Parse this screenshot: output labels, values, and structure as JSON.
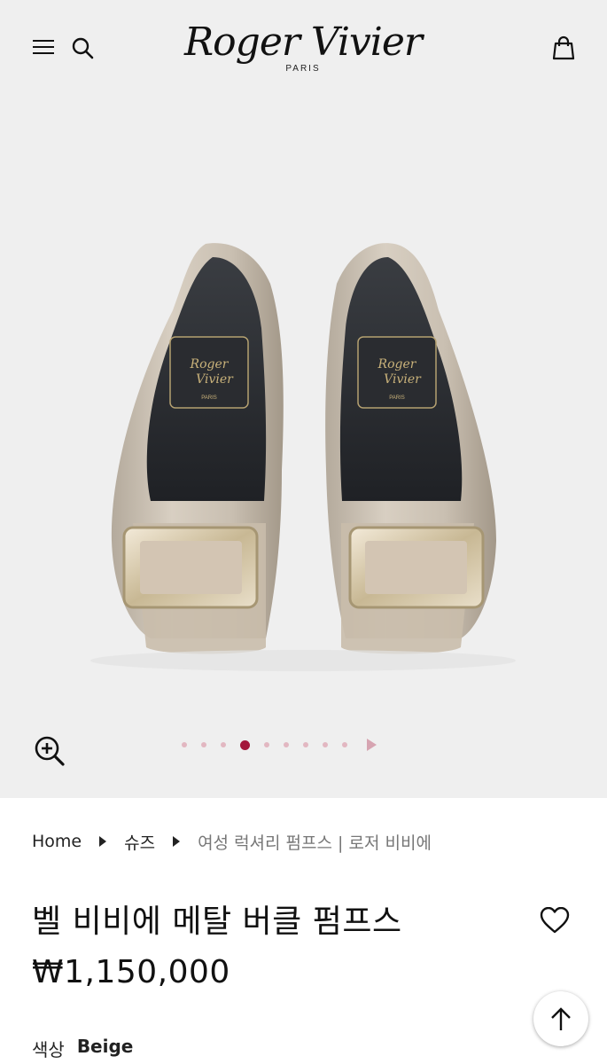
{
  "header": {
    "logo_text": "Roger Vivier",
    "logo_sub": "PARIS",
    "menu_icon": "hamburger-menu-icon",
    "search_icon": "search-icon",
    "cart_icon": "shopping-bag-icon"
  },
  "gallery": {
    "image_alt": "Beige patent pumps with metal buckle",
    "zoom_icon": "zoom-in-icon",
    "dot_count": 9,
    "active_dot": 4,
    "next_icon": "triangle-right-icon",
    "colors": {
      "active_dot": "#a3173a",
      "dot": "#e2b7c1"
    }
  },
  "breadcrumb": {
    "items": [
      "Home",
      "슈즈",
      "여성 럭셔리 펌프스 | 로저 비비에"
    ]
  },
  "product": {
    "title": "벨 비비에 메탈 버클 펌프스",
    "price": "₩1,150,000",
    "color_label": "색상",
    "color_value": "Beige",
    "wishlist_icon": "heart-icon"
  },
  "scroll_top_icon": "arrow-up-icon"
}
